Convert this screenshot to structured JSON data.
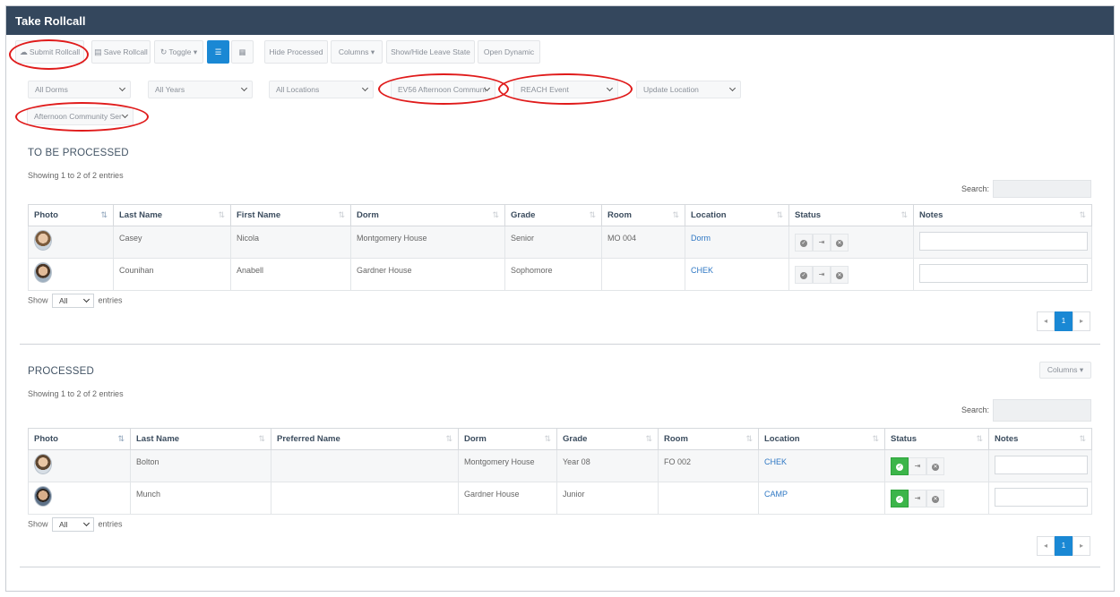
{
  "window": {
    "title": "Take Rollcall"
  },
  "toolbar": {
    "submit": "Submit Rollcall",
    "save": "Save Rollcall",
    "toggle": "Toggle",
    "hide_processed": "Hide Processed",
    "columns": "Columns",
    "show_hide_leave": "Show/Hide Leave State",
    "open_dynamic": "Open Dynamic"
  },
  "filters": {
    "dorms": "All Dorms",
    "years": "All Years",
    "locations": "All Locations",
    "event": "EV56 Afternoon Communi",
    "reach": "REACH Event",
    "update_location": "Update Location",
    "community": "Afternoon Community Ser"
  },
  "to_be_processed": {
    "title": "TO BE PROCESSED",
    "info": "Showing 1 to 2 of 2 entries",
    "search_label": "Search:",
    "headers": [
      "Photo",
      "Last Name",
      "First Name",
      "Dorm",
      "Grade",
      "Room",
      "Location",
      "Status",
      "Notes"
    ],
    "rows": [
      {
        "last": "Casey",
        "first": "Nicola",
        "dorm": "Montgomery House",
        "grade": "Senior",
        "room": "MO 004",
        "location": "Dorm"
      },
      {
        "last": "Counihan",
        "first": "Anabell",
        "dorm": "Gardner House",
        "grade": "Sophomore",
        "room": "",
        "location": "CHEK"
      }
    ],
    "show_label": "Show",
    "show_value": "All",
    "entries_label": "entries",
    "page": "1"
  },
  "processed": {
    "title": "PROCESSED",
    "columns_button": "Columns",
    "info": "Showing 1 to 2 of 2 entries",
    "search_label": "Search:",
    "headers": [
      "Photo",
      "Last Name",
      "Preferred Name",
      "Dorm",
      "Grade",
      "Room",
      "Location",
      "Status",
      "Notes"
    ],
    "rows": [
      {
        "last": "Bolton",
        "preferred": "",
        "dorm": "Montgomery House",
        "grade": "Year 08",
        "room": "FO 002",
        "location": "CHEK"
      },
      {
        "last": "Munch",
        "preferred": "",
        "dorm": "Gardner House",
        "grade": "Junior",
        "room": "",
        "location": "CAMP"
      }
    ],
    "show_label": "Show",
    "show_value": "All",
    "entries_label": "entries",
    "page": "1"
  },
  "colors": {
    "titlebar": "#34475d",
    "primary": "#1a88d4",
    "success": "#3cb54a",
    "annotation": "#e01b1b",
    "link": "#2f78c4"
  }
}
